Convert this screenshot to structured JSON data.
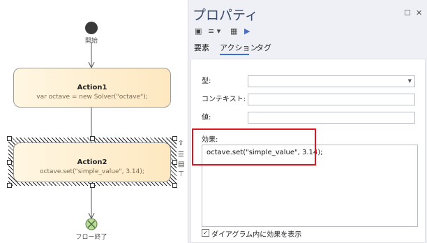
{
  "diagram": {
    "start_label": "開始",
    "end_label": "フロー終了",
    "action1": {
      "title": "Action1",
      "body": "var octave = new Solver(\"octave\");"
    },
    "action2": {
      "title": "Action2",
      "body": "octave.set(\"simple_value\", 3.14);"
    }
  },
  "panel": {
    "title": "プロパティ",
    "tabs": [
      "要素",
      "アクション",
      "タグ"
    ],
    "active_tab": "アクション",
    "fields": {
      "type_label": "型:",
      "context_label": "コンテキスト:",
      "value_label": "値:",
      "effect_label": "効果:",
      "effect_value": "octave.set(\"simple_value\", 3.14);"
    },
    "checkbox_label": "ダイアグラム内に効果を表示",
    "checkbox_checked": true
  },
  "colors": {
    "highlight": "#e0141e",
    "tab_accent": "#3a6fd8",
    "action_fill": "#fde8c0"
  },
  "icons": [
    "save-icon",
    "menu-icon",
    "properties-icon",
    "run-icon",
    "restore-icon",
    "close-icon"
  ]
}
